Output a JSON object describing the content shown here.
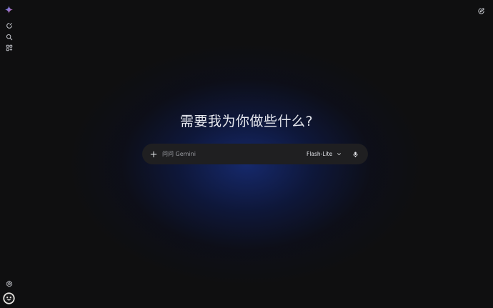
{
  "app": {
    "brand_icon": "gemini-spark-icon",
    "accent_colors": [
      "#4c8df6",
      "#d96570",
      "#9b72cb"
    ]
  },
  "sidebar": {
    "items": [
      {
        "icon": "new-chat-icon"
      },
      {
        "icon": "search-icon"
      },
      {
        "icon": "apps-grid-icon"
      }
    ],
    "bottom": [
      {
        "icon": "settings-gear-icon"
      },
      {
        "icon": "profile-avatar-icon"
      }
    ]
  },
  "header": {
    "new_chat_icon": "edit-pencil-icon"
  },
  "main": {
    "greeting": "需要我为你做些什么?"
  },
  "prompt": {
    "placeholder": "问问 Gemini",
    "value": "",
    "model": "Flash-Lite",
    "add_icon": "plus-icon",
    "dropdown_icon": "chevron-down-icon",
    "mic_icon": "microphone-icon"
  }
}
